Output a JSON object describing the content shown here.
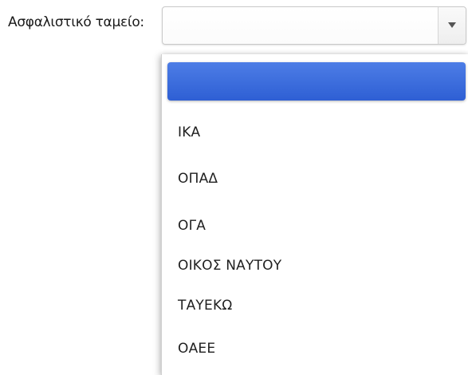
{
  "form": {
    "label": "Ασφαλιστικό ταμείο:",
    "selected_value": ""
  },
  "dropdown": {
    "options": [
      {
        "label": ""
      },
      {
        "label": "ΙΚΑ"
      },
      {
        "label": "ΟΠΑΔ"
      },
      {
        "label": "ΟΓΑ"
      },
      {
        "label": "ΟΙΚΟΣ ΝΑΥΤΟΥ"
      },
      {
        "label": "ΤΑΥΕΚΩ"
      },
      {
        "label": "ΟΑΕΕ"
      }
    ],
    "highlighted_index": 0
  },
  "colors": {
    "highlight": "#2e5fd4"
  },
  "icons": {
    "arrow": "chevron-down-icon"
  }
}
